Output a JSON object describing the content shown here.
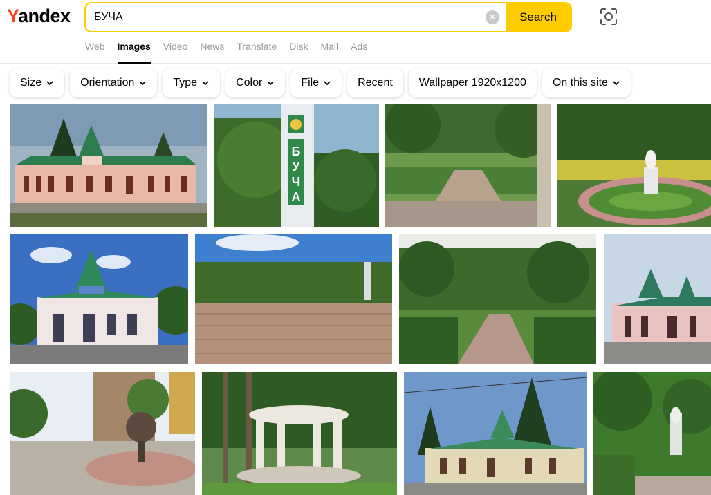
{
  "logo": {
    "letter": "Y",
    "rest": "andex"
  },
  "search": {
    "value": "БУЧА",
    "button_label": "Search",
    "clear_icon": "clear-icon",
    "camera_icon": "camera-search-icon"
  },
  "tabs": [
    "Web",
    "Images",
    "Video",
    "News",
    "Translate",
    "Disk",
    "Mail",
    "Ads"
  ],
  "active_tab": "Images",
  "filters": [
    {
      "label": "Size",
      "dropdown": true
    },
    {
      "label": "Orientation",
      "dropdown": true
    },
    {
      "label": "Type",
      "dropdown": true
    },
    {
      "label": "Color",
      "dropdown": true
    },
    {
      "label": "File",
      "dropdown": true
    },
    {
      "label": "Recent",
      "dropdown": false
    },
    {
      "label": "Wallpaper 1920x1200",
      "dropdown": false
    },
    {
      "label": "On this site",
      "dropdown": true
    }
  ],
  "station_sign": "БУЧА"
}
